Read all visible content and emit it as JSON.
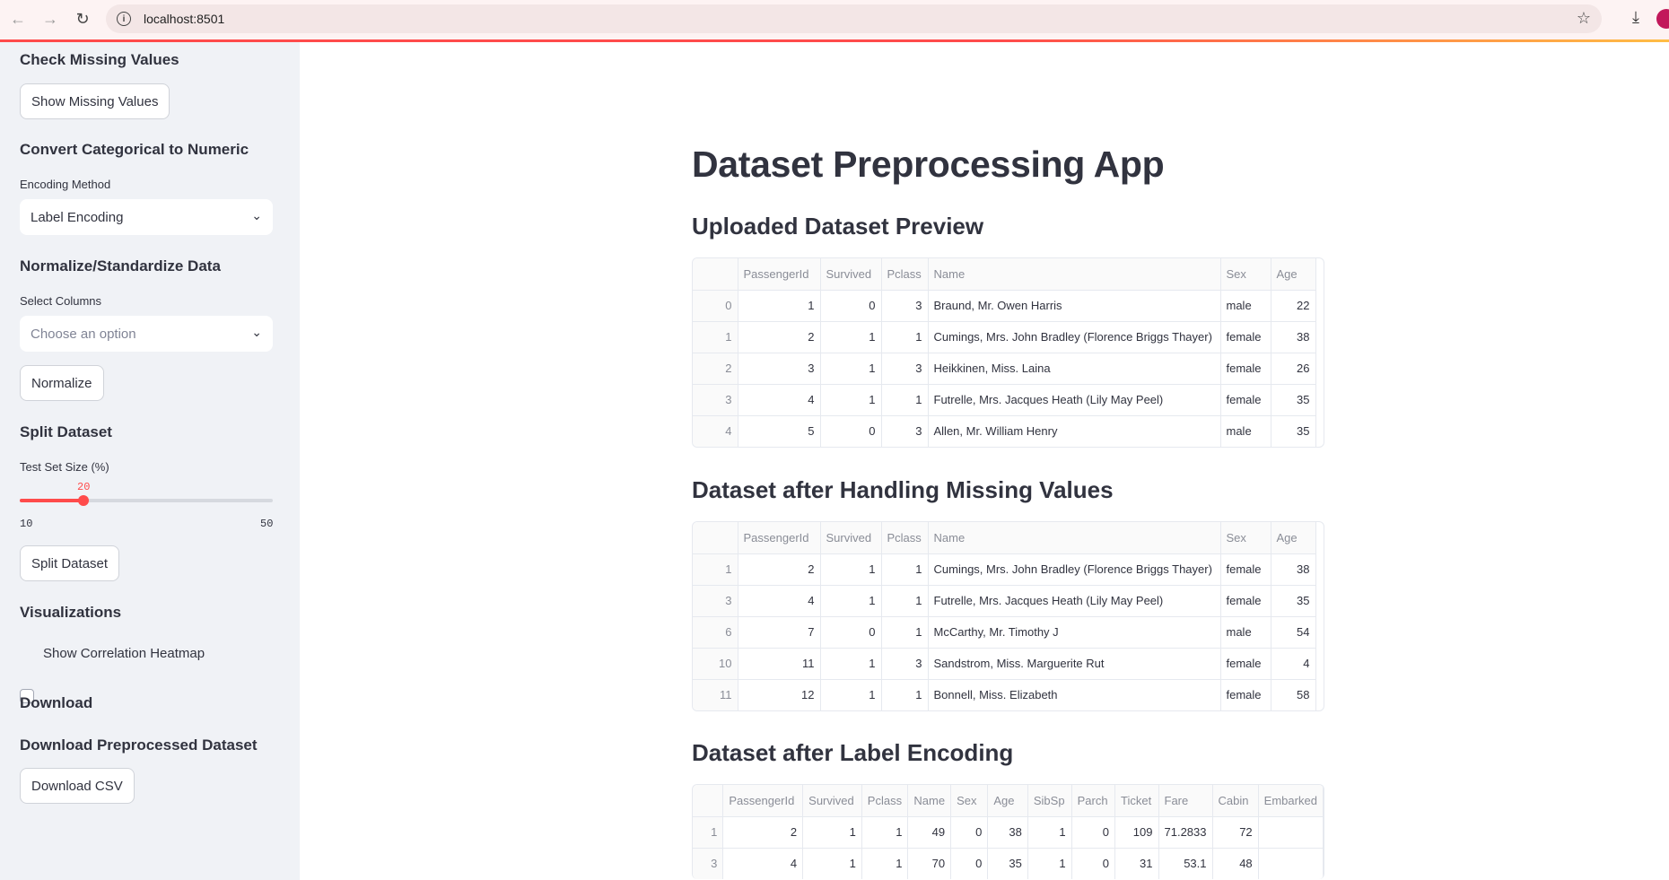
{
  "browser": {
    "url": "localhost:8501"
  },
  "sidebar": {
    "missing_heading": "Check Missing Values",
    "missing_button": "Show Missing Values",
    "convert_heading": "Convert Categorical to Numeric",
    "encoding_label": "Encoding Method",
    "encoding_value": "Label Encoding",
    "normalize_heading": "Normalize/Standardize Data",
    "columns_label": "Select Columns",
    "columns_placeholder": "Choose an option",
    "normalize_button": "Normalize",
    "split_heading": "Split Dataset",
    "test_size_label": "Test Set Size (%)",
    "test_size_value": "20",
    "test_size_min": "10",
    "test_size_max": "50",
    "test_size_fraction": 0.25,
    "split_button": "Split Dataset",
    "viz_heading": "Visualizations",
    "heatmap_label": "Show Correlation Heatmap",
    "download_heading": "Download",
    "download_sub_heading": "Download Preprocessed Dataset",
    "download_button": "Download CSV"
  },
  "main": {
    "title": "Dataset Preprocessing App",
    "preview": {
      "heading": "Uploaded Dataset Preview",
      "columns": [
        "",
        "PassengerId",
        "Survived",
        "Pclass",
        "Name",
        "Sex",
        "Age"
      ],
      "rows": [
        [
          "0",
          "1",
          "0",
          "3",
          "Braund, Mr. Owen Harris",
          "male",
          "22"
        ],
        [
          "1",
          "2",
          "1",
          "1",
          "Cumings, Mrs. John Bradley (Florence Briggs Thayer)",
          "female",
          "38"
        ],
        [
          "2",
          "3",
          "1",
          "3",
          "Heikkinen, Miss. Laina",
          "female",
          "26"
        ],
        [
          "3",
          "4",
          "1",
          "1",
          "Futrelle, Mrs. Jacques Heath (Lily May Peel)",
          "female",
          "35"
        ],
        [
          "4",
          "5",
          "0",
          "3",
          "Allen, Mr. William Henry",
          "male",
          "35"
        ]
      ]
    },
    "missing": {
      "heading": "Dataset after Handling Missing Values",
      "columns": [
        "",
        "PassengerId",
        "Survived",
        "Pclass",
        "Name",
        "Sex",
        "Age"
      ],
      "rows": [
        [
          "1",
          "2",
          "1",
          "1",
          "Cumings, Mrs. John Bradley (Florence Briggs Thayer)",
          "female",
          "38"
        ],
        [
          "3",
          "4",
          "1",
          "1",
          "Futrelle, Mrs. Jacques Heath (Lily May Peel)",
          "female",
          "35"
        ],
        [
          "6",
          "7",
          "0",
          "1",
          "McCarthy, Mr. Timothy J",
          "male",
          "54"
        ],
        [
          "10",
          "11",
          "1",
          "3",
          "Sandstrom, Miss. Marguerite Rut",
          "female",
          "4"
        ],
        [
          "11",
          "12",
          "1",
          "1",
          "Bonnell, Miss. Elizabeth",
          "female",
          "58"
        ]
      ]
    },
    "encoded": {
      "heading": "Dataset after Label Encoding",
      "columns": [
        "",
        "PassengerId",
        "Survived",
        "Pclass",
        "Name",
        "Sex",
        "Age",
        "SibSp",
        "Parch",
        "Ticket",
        "Fare",
        "Cabin",
        "Embarked"
      ],
      "rows": [
        [
          "1",
          "2",
          "1",
          "1",
          "49",
          "0",
          "38",
          "1",
          "0",
          "109",
          "71.2833",
          "72",
          ""
        ],
        [
          "3",
          "4",
          "1",
          "1",
          "70",
          "0",
          "35",
          "1",
          "0",
          "31",
          "53.1",
          "48",
          ""
        ]
      ]
    }
  }
}
